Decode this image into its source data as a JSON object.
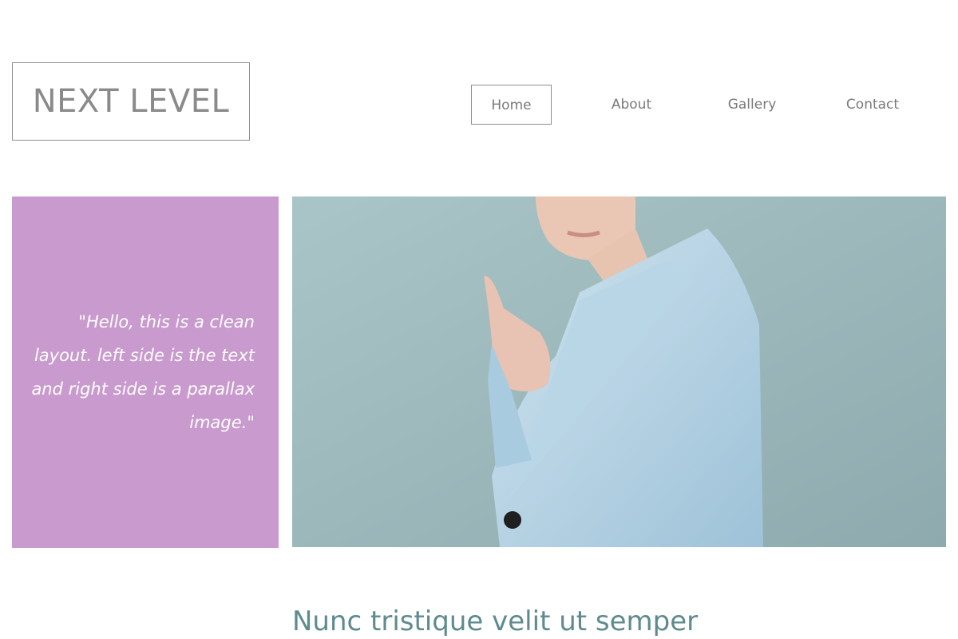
{
  "header": {
    "logo_text": "NEXT LEVEL",
    "nav": [
      {
        "label": "Home",
        "active": true
      },
      {
        "label": "About",
        "active": false
      },
      {
        "label": "Gallery",
        "active": false
      },
      {
        "label": "Contact",
        "active": false
      }
    ]
  },
  "hero": {
    "quote": "\"Hello, this is a clean layout. left side is the text and right side is a parallax image.\"",
    "quote_panel_color": "#c99acd",
    "image_subject": "woman-in-light-blue-blazer-pointing"
  },
  "main": {
    "headline": "Nunc tristique velit ut semper"
  },
  "colors": {
    "accent_teal": "#5e8b8e",
    "nav_text": "#7a7a7a",
    "border_gray": "#8f8f8f"
  }
}
